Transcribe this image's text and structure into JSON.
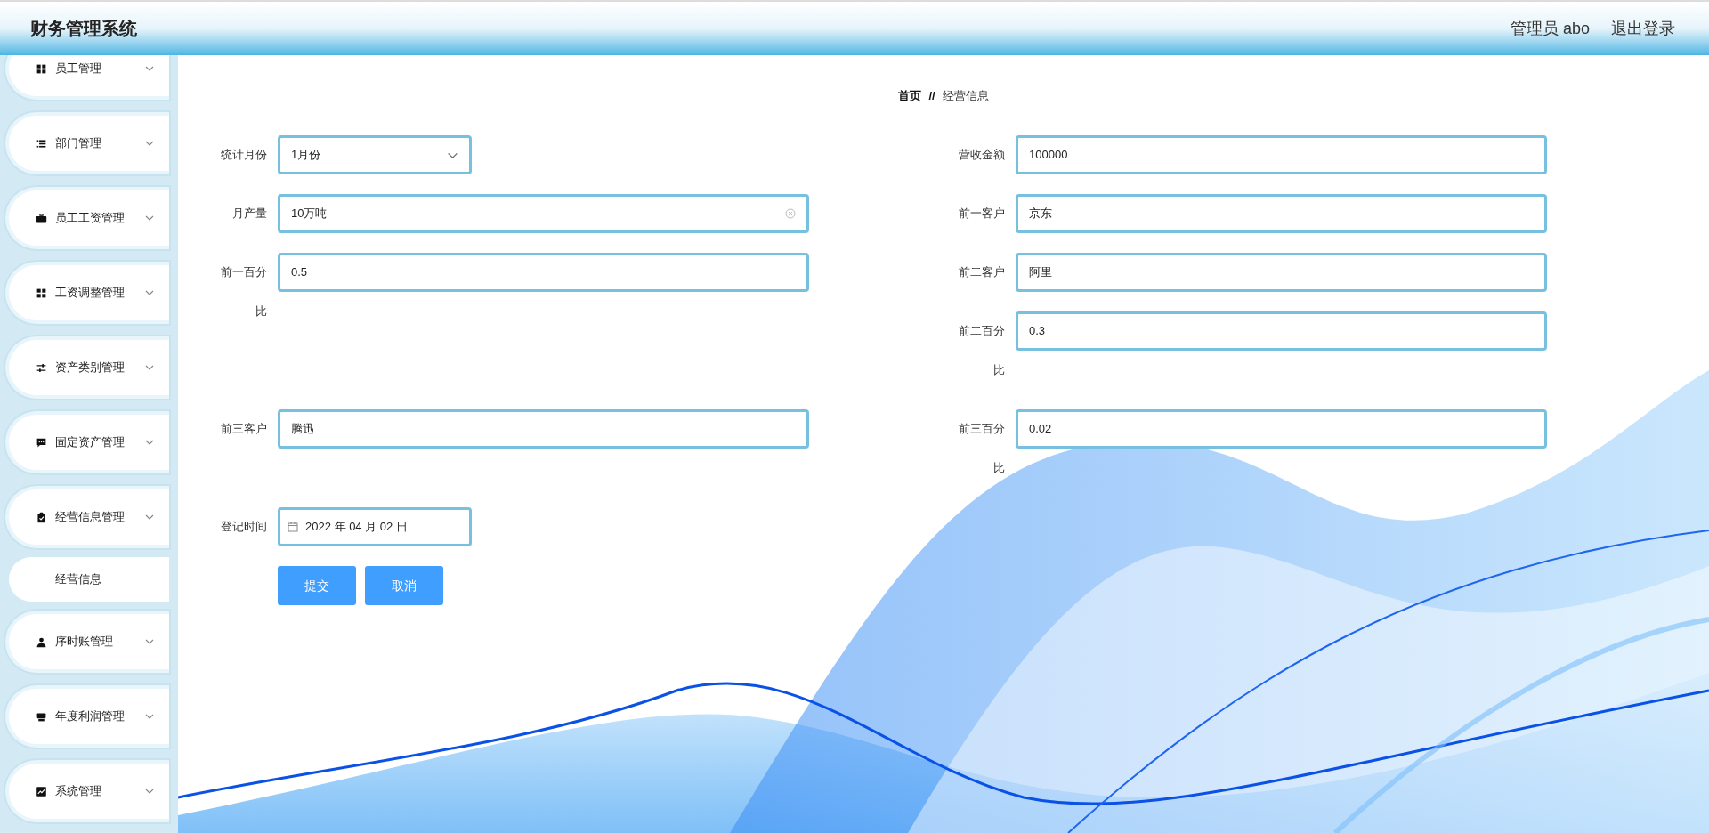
{
  "header": {
    "title": "财务管理系统",
    "user": "管理员 abo",
    "logout": "退出登录"
  },
  "sidebar": {
    "items": [
      {
        "label": "员工管理"
      },
      {
        "label": "部门管理"
      },
      {
        "label": "员工工资管理"
      },
      {
        "label": "工资调整管理"
      },
      {
        "label": "资产类别管理"
      },
      {
        "label": "固定资产管理"
      },
      {
        "label": "经营信息管理",
        "children": [
          {
            "label": "经营信息",
            "selected": true
          }
        ]
      },
      {
        "label": "序时账管理"
      },
      {
        "label": "年度利润管理"
      },
      {
        "label": "系统管理"
      }
    ]
  },
  "breadcrumb": {
    "home": "首页",
    "separator": "//",
    "current": "经营信息"
  },
  "form": {
    "fields": [
      {
        "label": "统计月份",
        "kind": "select",
        "value": "1月份"
      },
      {
        "label": "营收金额",
        "kind": "text",
        "value": "100000"
      },
      {
        "label": "月产量",
        "kind": "text",
        "value": "10万吨",
        "focused": true
      },
      {
        "label": "前一客户",
        "kind": "text",
        "value": "京东"
      },
      {
        "label": "前一百分比",
        "kind": "text",
        "value": "0.5"
      },
      {
        "label": "前二客户",
        "kind": "text",
        "value": "阿里"
      },
      {
        "label": "前二百分比",
        "kind": "text",
        "value": "0.3"
      },
      {
        "label": "前三客户",
        "kind": "text",
        "value": "腾迅"
      },
      {
        "label": "前三百分比",
        "kind": "text",
        "value": "0.02"
      },
      {
        "label": "登记时间",
        "kind": "date",
        "value": "2022 年 04 月 02 日"
      }
    ],
    "buttons": [
      "提交",
      "取消"
    ]
  }
}
